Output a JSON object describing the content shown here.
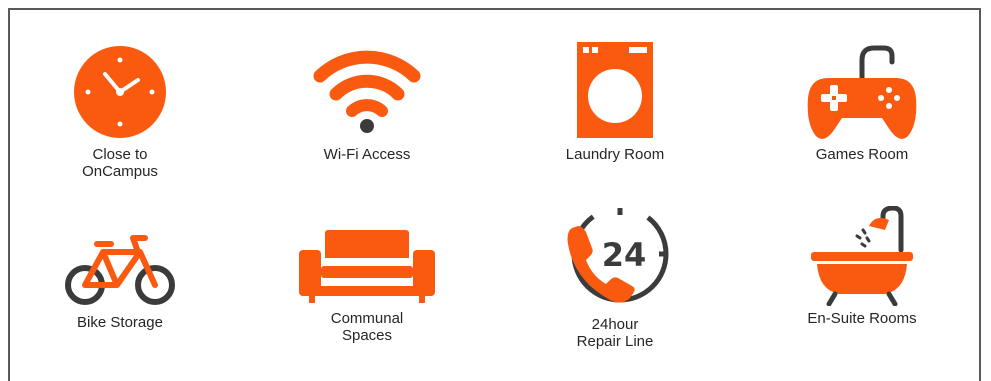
{
  "colors": {
    "accent": "#f95a0f",
    "dark": "#3b3b3b",
    "border": "#5a5a5a"
  },
  "features": [
    {
      "icon": "clock-icon",
      "label": "Close to\nOnCampus"
    },
    {
      "icon": "wifi-icon",
      "label": "Wi-Fi Access"
    },
    {
      "icon": "washing-machine-icon",
      "label": "Laundry Room"
    },
    {
      "icon": "gamepad-icon",
      "label": "Games Room"
    },
    {
      "icon": "bicycle-icon",
      "label": "Bike Storage"
    },
    {
      "icon": "sofa-icon",
      "label": "Communal\nSpaces"
    },
    {
      "icon": "phone-24-icon",
      "label": "24hour\nRepair Line",
      "badge": "24"
    },
    {
      "icon": "bathtub-icon",
      "label": "En-Suite Rooms"
    }
  ]
}
